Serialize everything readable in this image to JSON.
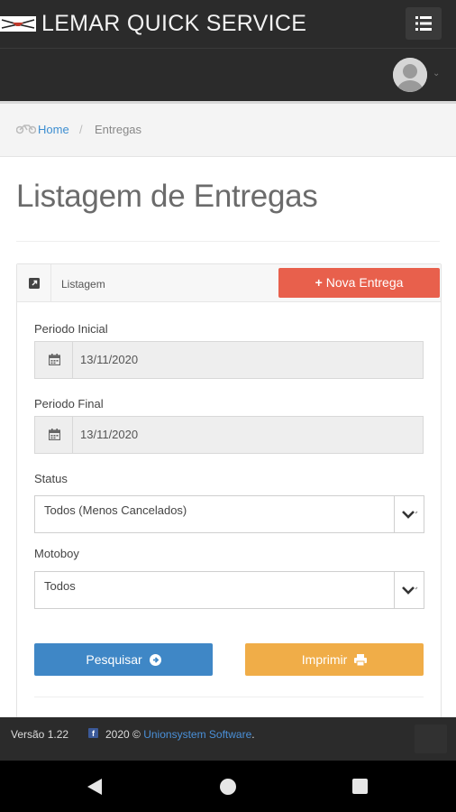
{
  "header": {
    "app_title": "LEMAR QUICK SERVICE"
  },
  "breadcrumb": {
    "home": "Home",
    "separator": "/",
    "current": "Entregas"
  },
  "page": {
    "title": "Listagem de Entregas"
  },
  "panel": {
    "label": "Listagem",
    "new_button": "Nova Entrega",
    "new_button_icon": "+"
  },
  "form": {
    "periodo_inicial": {
      "label": "Periodo Inicial",
      "value": "13/11/2020"
    },
    "periodo_final": {
      "label": "Periodo Final",
      "value": "13/11/2020"
    },
    "status": {
      "label": "Status",
      "value": "Todos (Menos Cancelados)"
    },
    "motoboy": {
      "label": "Motoboy",
      "value": "Todos"
    }
  },
  "actions": {
    "search": "Pesquisar",
    "print": "Imprimir"
  },
  "footer": {
    "version": "Versão 1.22",
    "year": "2020 ©",
    "company": "Unionsystem Software",
    "period": "."
  },
  "colors": {
    "topbar": "#2b2b2b",
    "new_button": "#e8604c",
    "search_button": "#3f87c6",
    "print_button": "#f0ad48",
    "link": "#3d8ed1"
  },
  "icons": {
    "logo": "flag-logo",
    "menu": "list-icon",
    "breadcrumb": "motorcycle-icon",
    "panel": "external-link-icon",
    "date": "calendar-icon",
    "select": "chevron-down-icon",
    "search": "arrow-circle-right-icon",
    "print": "print-icon"
  }
}
